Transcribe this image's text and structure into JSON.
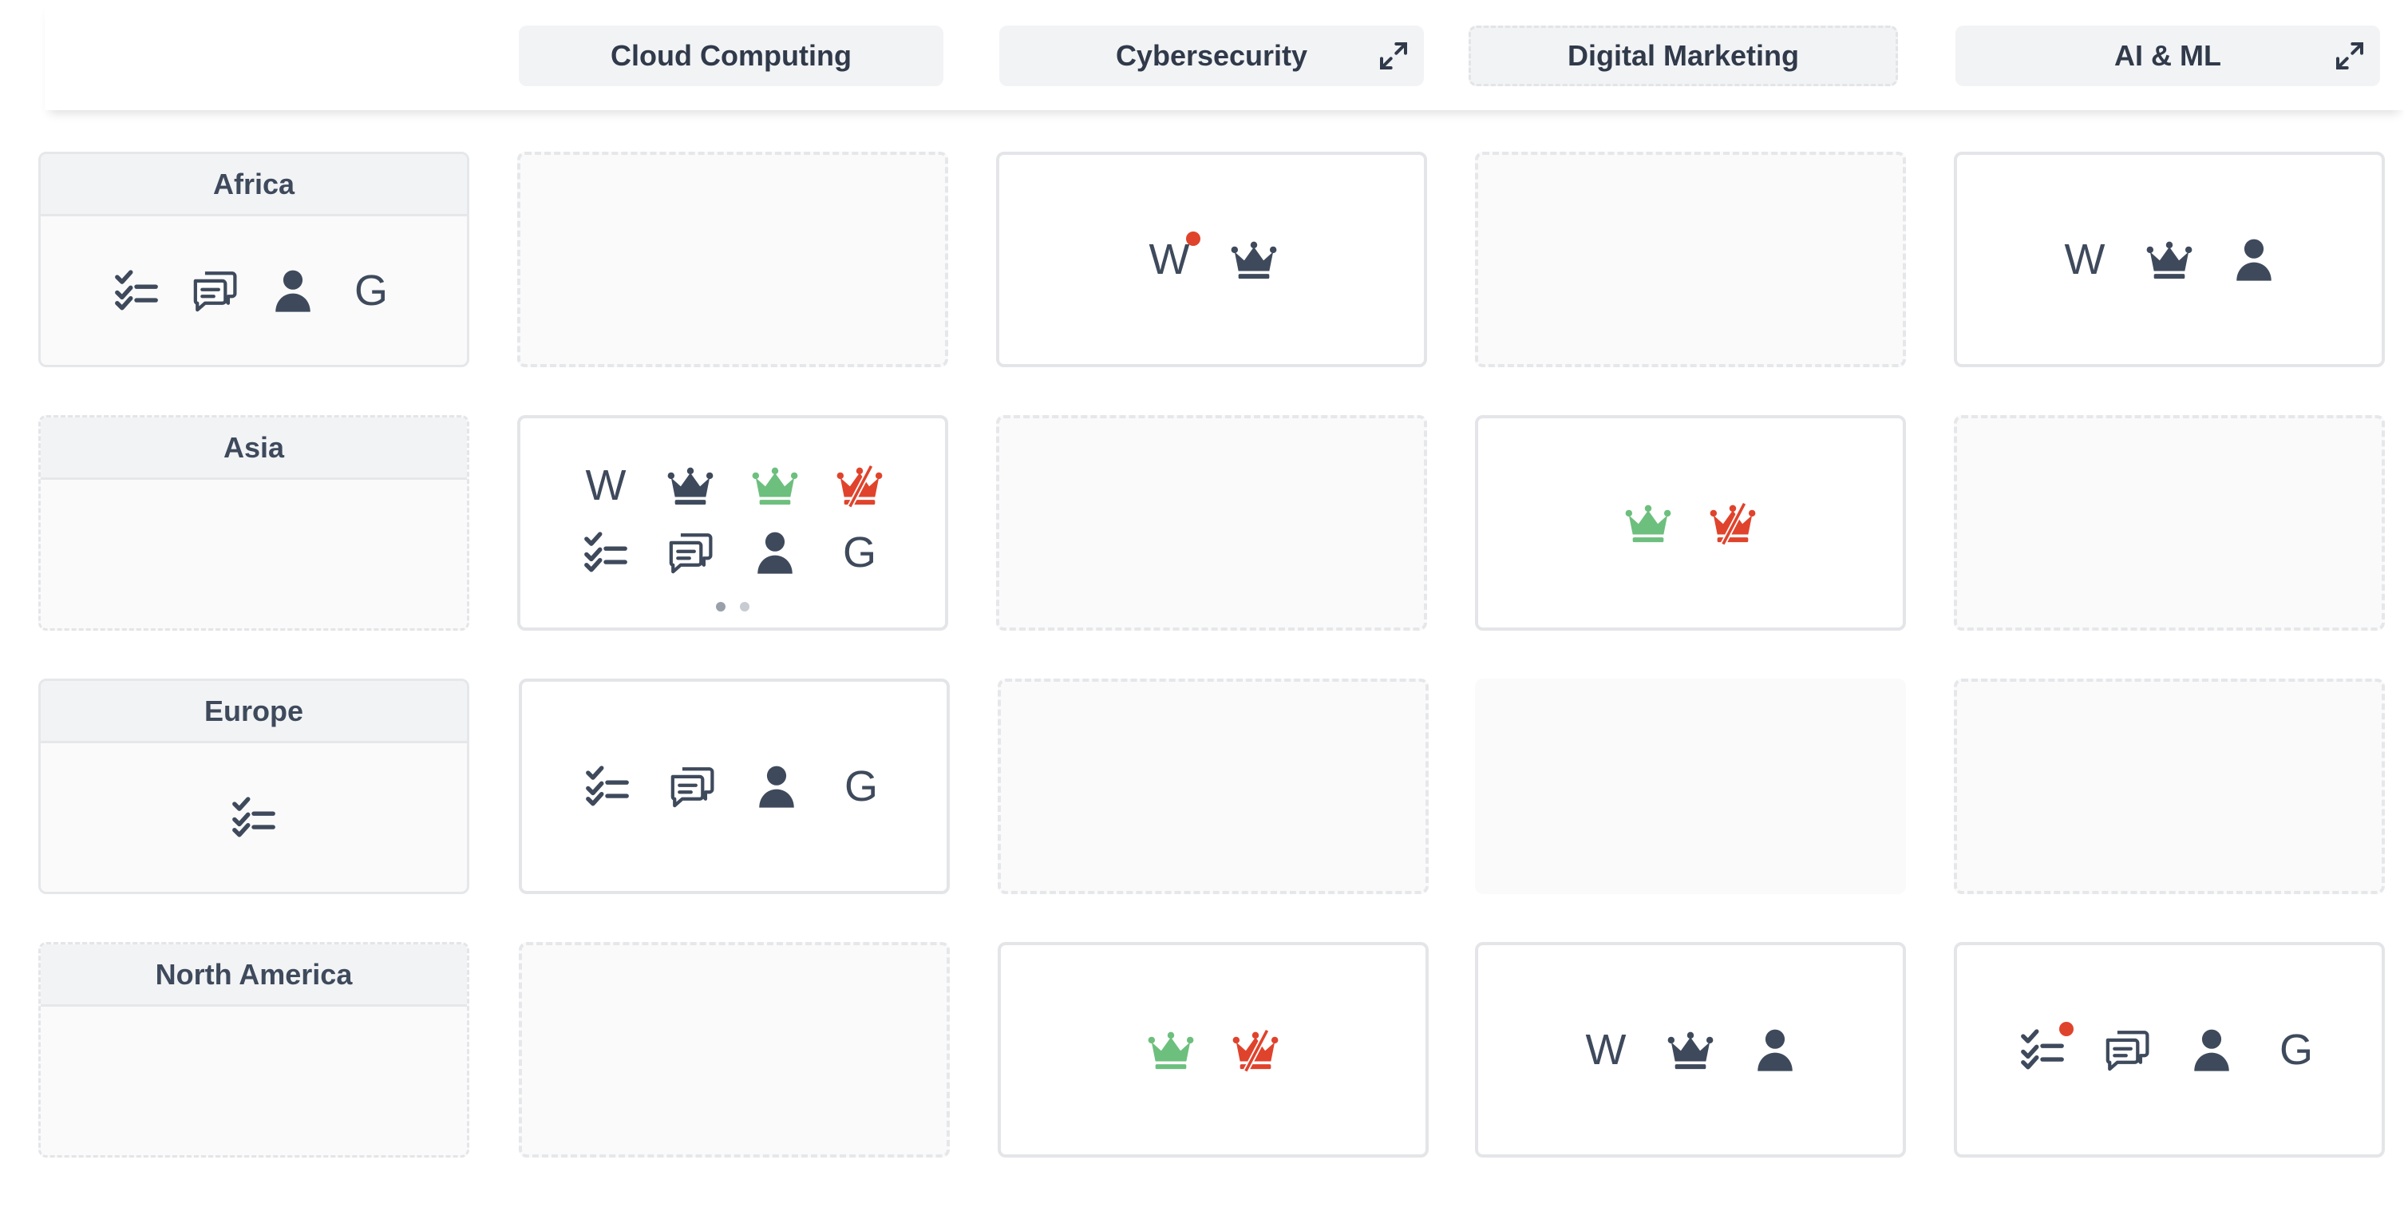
{
  "columns": [
    {
      "label": "Cloud Computing",
      "expand_icon": false
    },
    {
      "label": "Cybersecurity",
      "expand_icon": true
    },
    {
      "label": "Digital Marketing",
      "expand_icon": false
    },
    {
      "label": "AI & ML",
      "expand_icon": true
    }
  ],
  "rows": [
    {
      "label": "Africa",
      "icons": [
        "checklist-icon",
        "chat-icon",
        "person-icon",
        "letter-g"
      ]
    },
    {
      "label": "Asia",
      "icons": []
    },
    {
      "label": "Europe",
      "icons": [
        "checklist-icon"
      ]
    },
    {
      "label": "North America",
      "icons": []
    }
  ],
  "letters": {
    "w": "W",
    "g": "G"
  },
  "cells": {
    "africa_cyber": [
      "letter-w",
      "crown-icon"
    ],
    "africa_ai": [
      "letter-w",
      "crown-icon",
      "person-icon"
    ],
    "asia_cloud": [
      "letter-w",
      "crown-icon",
      "crown-green-icon",
      "crown-crossed-icon",
      "checklist-icon",
      "chat-icon",
      "person-icon",
      "letter-g"
    ],
    "asia_digital": [
      "crown-green-icon",
      "crown-crossed-icon"
    ],
    "europe_cloud": [
      "checklist-icon",
      "chat-icon",
      "person-icon",
      "letter-g"
    ],
    "na_cyber": [
      "crown-green-icon",
      "crown-crossed-icon"
    ],
    "na_digital": [
      "letter-w",
      "crown-icon",
      "person-icon"
    ],
    "na_ai": [
      "checklist-icon",
      "chat-icon",
      "person-icon",
      "letter-g"
    ]
  },
  "colors": {
    "icon": "#3e4a5c",
    "green": "#6dbf7e",
    "red": "#e0432c"
  }
}
